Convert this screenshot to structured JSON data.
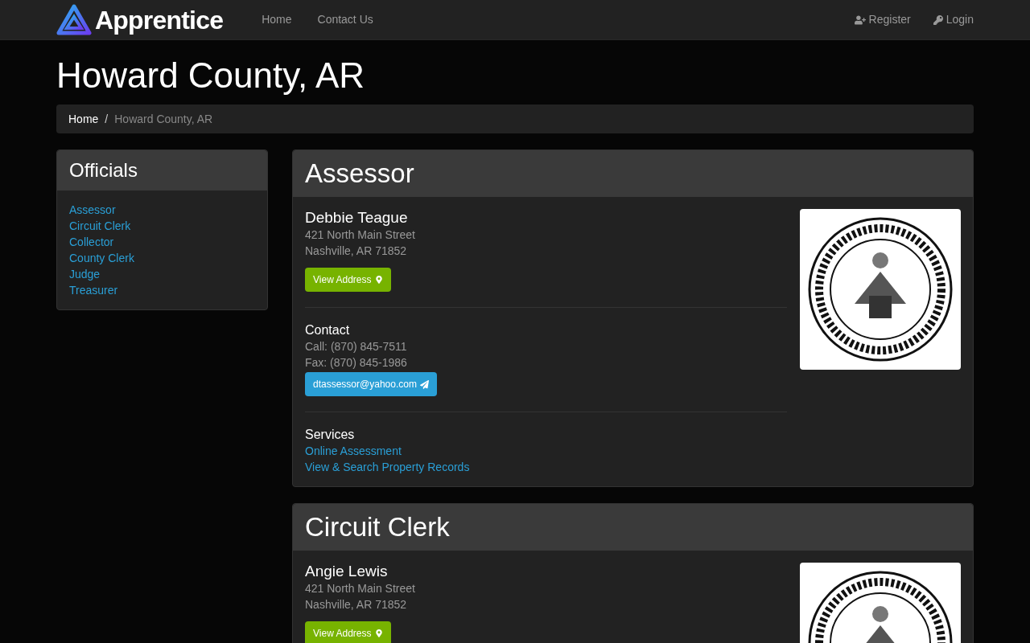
{
  "navbar": {
    "brand": "Apprentice",
    "links": [
      "Home",
      "Contact Us"
    ],
    "account_links": [
      {
        "kind": "register",
        "label": "Register"
      },
      {
        "kind": "login",
        "label": "Login"
      }
    ]
  },
  "page_title": "Howard County, AR",
  "breadcrumb_separator": "/",
  "breadcrumb": [
    {
      "label": "Home",
      "active": false
    },
    {
      "label": "Howard County, AR",
      "active": true
    }
  ],
  "sidebar": {
    "title": "Officials",
    "items": [
      "Assessor",
      "Circuit Clerk",
      "Collector",
      "County Clerk",
      "Judge",
      "Treasurer"
    ]
  },
  "offices": [
    {
      "title": "Assessor",
      "name": "Debbie Teague",
      "address": [
        "421 North Main Street",
        "Nashville, AR 71852"
      ],
      "address_button": "View Address",
      "contact": {
        "heading": "Contact",
        "lines": [
          "Call: (870) 845-7511",
          "Fax: (870) 845-1986"
        ],
        "email": "dtassessor@yahoo.com"
      },
      "services": {
        "heading": "Services",
        "links": [
          "Online Assessment",
          "View & Search Property Records"
        ]
      }
    },
    {
      "title": "Circuit Clerk",
      "name": "Angie Lewis",
      "address": [
        "421 North Main Street",
        "Nashville, AR 71852"
      ],
      "address_button": "View Address"
    }
  ]
}
